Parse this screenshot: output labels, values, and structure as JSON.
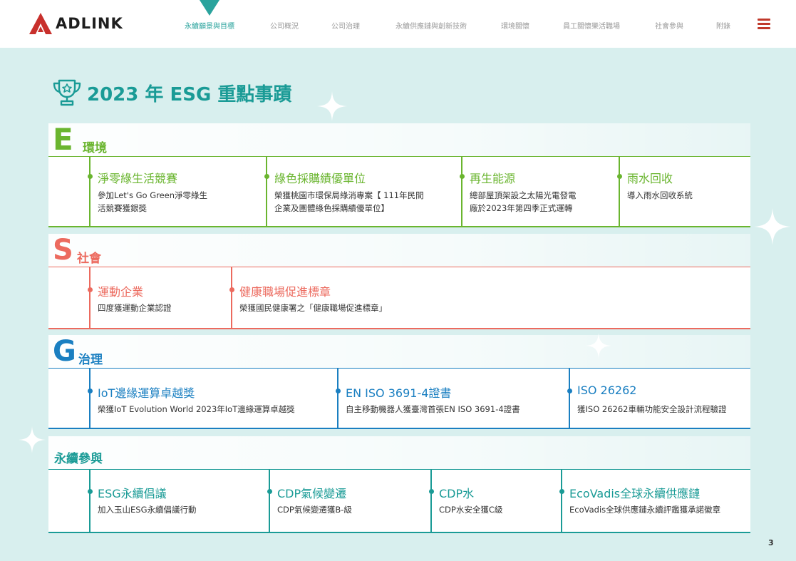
{
  "brand": {
    "name": "ADLINK"
  },
  "nav": {
    "items": [
      {
        "label": "永續願景與目標",
        "active": true
      },
      {
        "label": "公司概況"
      },
      {
        "label": "公司治理"
      },
      {
        "label": "永續供應鏈與創新技術"
      },
      {
        "label": "環境關懷"
      },
      {
        "label": "員工關懷樂活職場"
      },
      {
        "label": "社會參與"
      },
      {
        "label": "附錄"
      }
    ],
    "menu_icon": "hamburger-menu-icon"
  },
  "page": {
    "title": "2023 年 ESG 重點事蹟",
    "title_icon": "trophy-icon",
    "page_number": "3"
  },
  "colors": {
    "teal": "#1a9b96",
    "green": "#6ab52f",
    "coral": "#ec6a5e",
    "blue": "#1a7fc1",
    "sustain": "#1a9b96"
  },
  "sections": {
    "env": {
      "letter": "E",
      "label": "環境",
      "items": [
        {
          "title": "淨零綠生活競賽",
          "desc": [
            "參加Let's Go Green淨零綠生",
            "活競賽獲銀獎"
          ]
        },
        {
          "title": "綠色採購績優單位",
          "desc": [
            "榮獲桃園市環保局綠消專案【 111年民間",
            "企業及團體綠色採購績優單位】"
          ]
        },
        {
          "title": "再生能源",
          "desc": [
            "總部屋頂架設之太陽光電發電",
            "廠於2023年第四季正式運轉"
          ]
        },
        {
          "title": "雨水回收",
          "desc": [
            "導入雨水回收系統"
          ]
        }
      ]
    },
    "soc": {
      "letter": "S",
      "label": "社會",
      "items": [
        {
          "title": "運動企業",
          "desc": [
            "四度獲運動企業認證"
          ]
        },
        {
          "title": "健康職場促進標章",
          "desc": [
            "榮獲國民健康署之「健康職場促進標章」"
          ]
        }
      ]
    },
    "gov": {
      "letter": "G",
      "label": "治理",
      "items": [
        {
          "title": "IoT邊緣運算卓越獎",
          "desc": [
            "榮獲IoT Evolution World 2023年IoT邊緣運算卓越獎"
          ]
        },
        {
          "title": "EN ISO 3691-4證書",
          "desc": [
            "自主移動機器人獲臺灣首張EN ISO 3691-4證書"
          ]
        },
        {
          "title": "ISO 26262",
          "desc": [
            "獲ISO 26262車輛功能安全設計流程驗證"
          ]
        }
      ]
    },
    "sus": {
      "letter": "",
      "label": "永續參與",
      "items": [
        {
          "title": "ESG永續倡議",
          "desc": [
            "加入玉山ESG永續倡議行動"
          ]
        },
        {
          "title": "CDP氣候變遷",
          "desc": [
            "CDP氣候變遷獲B-級"
          ]
        },
        {
          "title": "CDP水",
          "desc": [
            "CDP水安全獲C級"
          ]
        },
        {
          "title": "EcoVadis全球永續供應鏈",
          "desc": [
            "EcoVadis全球供應鏈永續評鑑獲承諾徽章"
          ]
        }
      ]
    }
  }
}
